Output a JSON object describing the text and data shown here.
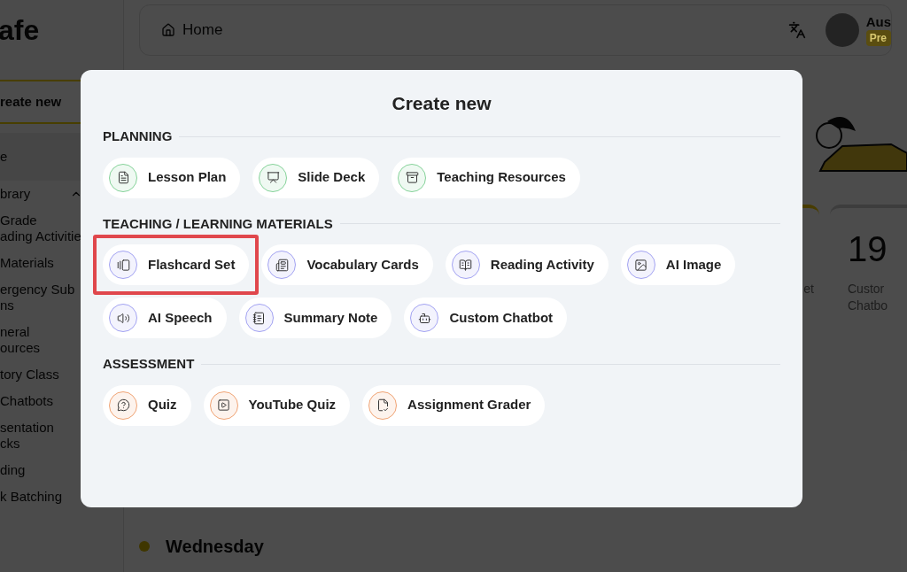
{
  "sidebar": {
    "logo": "afe",
    "create_button": "reate new",
    "items": [
      {
        "lines": [
          "e"
        ],
        "selected": true
      },
      {
        "lines": [
          "brary"
        ],
        "selected": false,
        "expanded": true
      },
      {
        "lines": [
          "Grade",
          "ading Activitie"
        ],
        "selected": false
      },
      {
        "lines": [
          "Materials"
        ],
        "selected": false
      },
      {
        "lines": [
          "ergency Sub",
          "ns"
        ],
        "selected": false
      },
      {
        "lines": [
          "neral",
          "ources"
        ],
        "selected": false
      },
      {
        "lines": [
          "tory Class"
        ],
        "selected": false
      },
      {
        "lines": [
          "Chatbots"
        ],
        "selected": false
      },
      {
        "lines": [
          "sentation",
          "cks"
        ],
        "selected": false
      },
      {
        "lines": [
          "ding"
        ],
        "selected": false
      },
      {
        "lines": [
          "k Batching"
        ],
        "selected": false
      }
    ]
  },
  "header": {
    "title": "Home",
    "user": {
      "name": "Aus",
      "badge": "Pre"
    }
  },
  "stat_cards": [
    {
      "label_lines": [
        "et"
      ]
    },
    {
      "value": "19",
      "label_lines": [
        "Custor",
        "Chatbo"
      ]
    }
  ],
  "day": "Wednesday",
  "modal": {
    "title": "Create new",
    "sections": [
      {
        "title": "PLANNING",
        "color": "#86d39a",
        "items": [
          {
            "label": "Lesson Plan",
            "highlighted": false
          },
          {
            "label": "Slide Deck",
            "highlighted": false
          },
          {
            "label": "Teaching Resources",
            "highlighted": false
          }
        ]
      },
      {
        "title": "TEACHING / LEARNING MATERIALS",
        "color": "#a3a3f2",
        "items": [
          {
            "label": "Flashcard Set",
            "highlighted": true
          },
          {
            "label": "Vocabulary Cards",
            "highlighted": false
          },
          {
            "label": "Reading Activity",
            "highlighted": false
          },
          {
            "label": "AI Image",
            "highlighted": false
          },
          {
            "label": "AI Speech",
            "highlighted": false
          },
          {
            "label": "Summary Note",
            "highlighted": false
          },
          {
            "label": "Custom Chatbot",
            "highlighted": false
          }
        ]
      },
      {
        "title": "ASSESSMENT",
        "color": "#f0a475",
        "items": [
          {
            "label": "Quiz",
            "highlighted": false
          },
          {
            "label": "YouTube Quiz",
            "highlighted": false
          },
          {
            "label": "Assignment Grader",
            "highlighted": false
          }
        ]
      }
    ]
  }
}
